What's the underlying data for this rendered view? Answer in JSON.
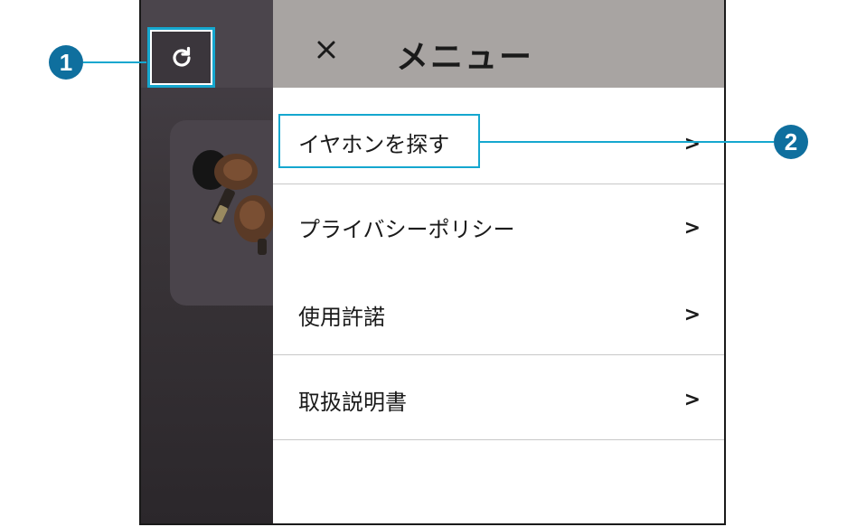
{
  "menu": {
    "title": "メニュー",
    "close_icon": "close-icon",
    "items": [
      {
        "label": "イヤホンを探す",
        "chevron": ">"
      },
      {
        "label": "プライバシーポリシー",
        "chevron": ">"
      },
      {
        "label": "使用許諾",
        "chevron": ">"
      },
      {
        "label": "取扱説明書",
        "chevron": ">"
      }
    ]
  },
  "background_app": {
    "refresh_icon": "refresh-icon",
    "product_image": "earbuds-image"
  },
  "callouts": [
    {
      "number": "1"
    },
    {
      "number": "2"
    }
  ],
  "colors": {
    "callout_fill": "#0f6f9e",
    "highlight": "#15a7cf",
    "menu_header": "#a8a4a2",
    "dim_overlay": "#2e2a30"
  }
}
